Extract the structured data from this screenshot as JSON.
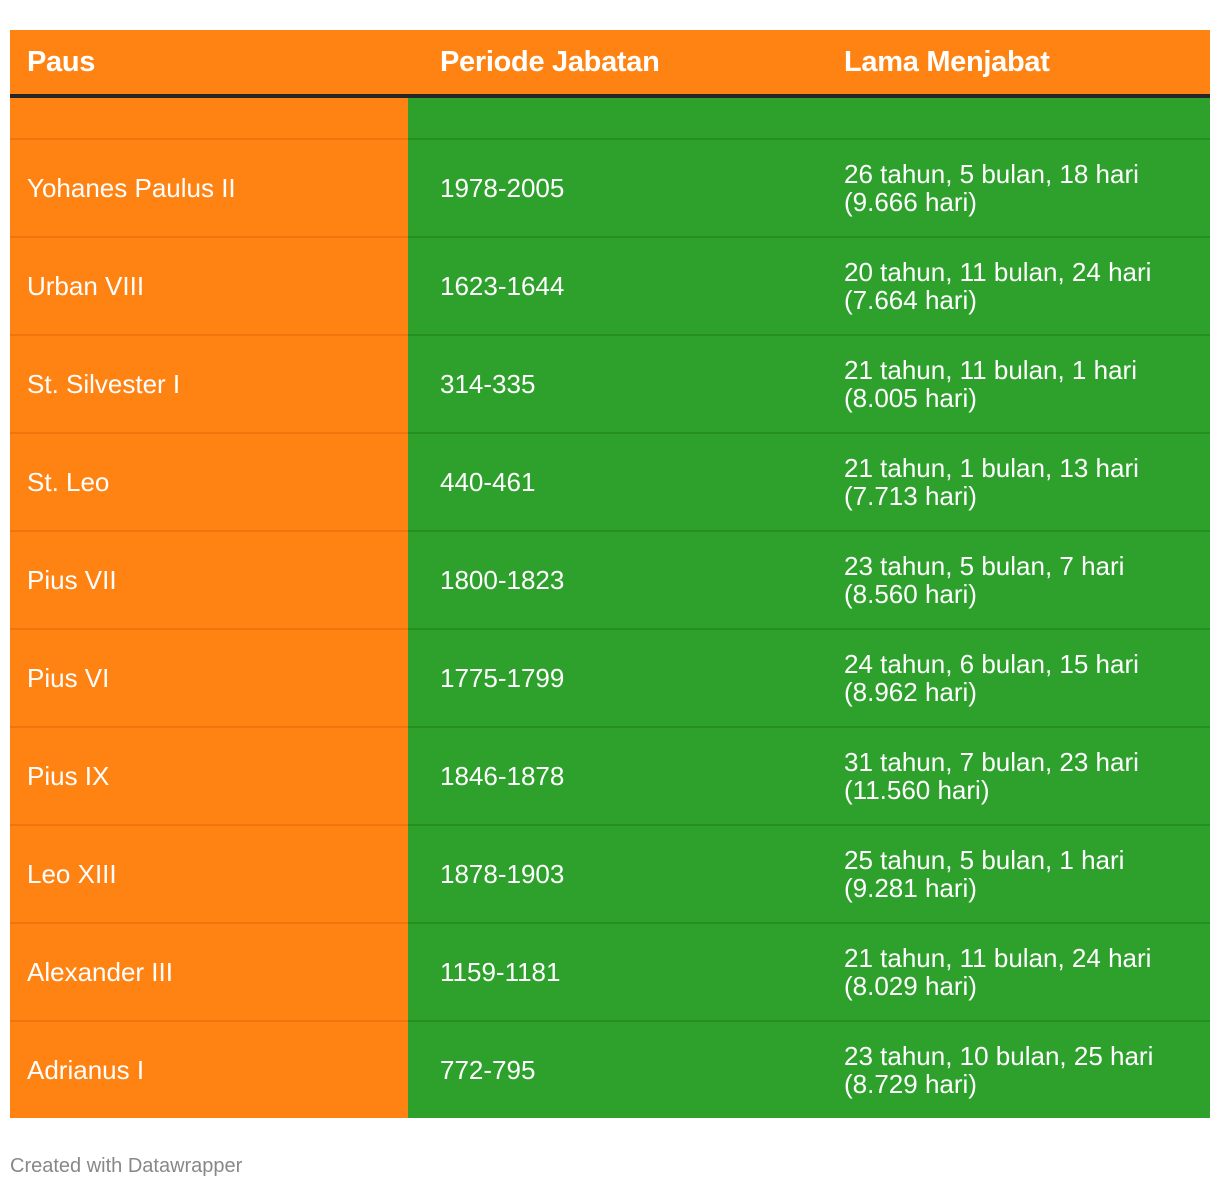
{
  "chart_data": {
    "type": "table",
    "columns": [
      "Paus",
      "Periode Jabatan",
      "Lama Menjabat"
    ],
    "rows": [
      {
        "name": "Yohanes Paulus II",
        "period": "1978-2005",
        "duration": "26 tahun, 5 bulan, 18 hari",
        "days": "(9.666 hari)"
      },
      {
        "name": "Urban VIII",
        "period": "1623-1644",
        "duration": "20 tahun, 11 bulan, 24 hari",
        "days": "(7.664 hari)"
      },
      {
        "name": "St. Silvester I",
        "period": "314-335",
        "duration": "21 tahun, 11 bulan, 1 hari",
        "days": "(8.005 hari)"
      },
      {
        "name": "St. Leo",
        "period": "440-461",
        "duration": "21 tahun, 1 bulan, 13 hari",
        "days": "(7.713 hari)"
      },
      {
        "name": "Pius VII",
        "period": "1800-1823",
        "duration": "23 tahun, 5 bulan, 7 hari",
        "days": "(8.560 hari)"
      },
      {
        "name": "Pius VI",
        "period": "1775-1799",
        "duration": "24 tahun, 6 bulan, 15 hari",
        "days": "(8.962 hari)"
      },
      {
        "name": "Pius IX",
        "period": "1846-1878",
        "duration": "31 tahun, 7 bulan, 23 hari",
        "days": "(11.560 hari)"
      },
      {
        "name": "Leo XIII",
        "period": "1878-1903",
        "duration": "25 tahun, 5 bulan, 1 hari",
        "days": "(9.281 hari)"
      },
      {
        "name": "Alexander III",
        "period": "1159-1181",
        "duration": "21 tahun, 11 bulan, 24 hari",
        "days": "(8.029 hari)"
      },
      {
        "name": "Adrianus I",
        "period": "772-795",
        "duration": "23 tahun, 10 bulan, 25 hari",
        "days": "(8.729 hari)"
      }
    ]
  },
  "colors": {
    "header_bg": "#ff8313",
    "name_column_bg": "#ff8313",
    "data_columns_bg": "#2ea12c",
    "text": "#ffffff"
  },
  "footer": {
    "credit": "Created with Datawrapper"
  }
}
